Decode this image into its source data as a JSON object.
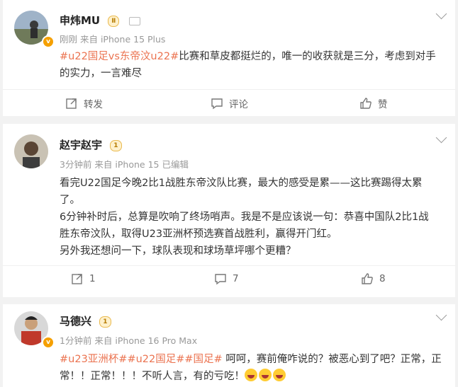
{
  "comments": [
    {
      "name": "申炜MU",
      "level": "Ⅱ",
      "meta": "刚刚  来自 iPhone 15 Plus",
      "tags": "#u22国足vs东帝汶u22#",
      "text1": "比赛和草皮都挺烂的，唯一的收获就是三分，考虑到对手",
      "text2": "的实力，一言难尽",
      "repost": "转发",
      "comment": "评论",
      "like": "赞"
    },
    {
      "name": "赵宇赵宇",
      "level": "1",
      "meta": "3分钟前  来自 iPhone 15 已编辑",
      "line1": "看完U22国足今晚2比1战胜东帝汶队比赛，最大的感受是累——这比赛踢得太累",
      "line2": "了。",
      "line3": "6分钟补时后，总算是吹响了终场哨声。我是不是应该说一句：恭喜中国队2比1战",
      "line4": "胜东帝汶队，取得U23亚洲杯预选赛首战胜利，赢得开门红。",
      "line5": "另外我还想问一下，球队表现和球场草坪哪个更糟？",
      "repost": "1",
      "comment": "7",
      "like": "8"
    },
    {
      "name": "马德兴",
      "level": "1",
      "meta": "1分钟前  来自 iPhone 16 Pro Max",
      "tags": "#u23亚洲杯##u22国足##国足#",
      "text1": " 呵呵，赛前俺咋说的？被恶心到了吧？正常，正",
      "text2": "常！！正常！！！不听人言，有的亏吃！"
    }
  ]
}
